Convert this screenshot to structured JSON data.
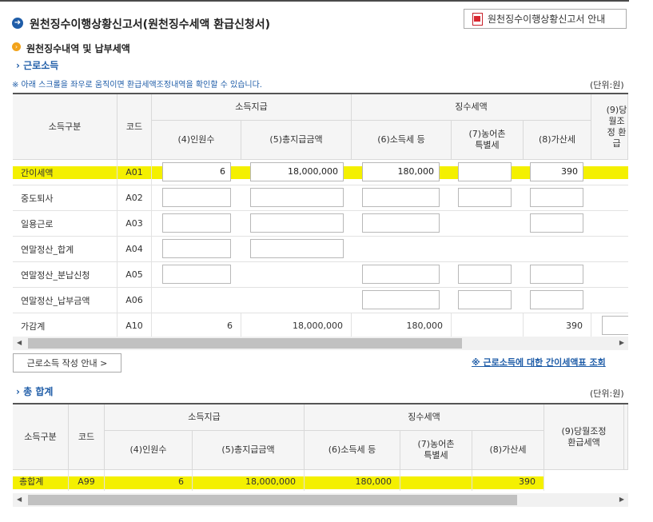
{
  "header": {
    "title": "원천징수이행상황신고서(원천징수세액 환급신청서)",
    "guide_button": "원천징수이행상황신고서 안내",
    "section_title": "원천징수내역 및 납부세액"
  },
  "earned_income": {
    "section_label": "근로소득",
    "notice": "※ 아래 스크롤을 좌우로 움직이면 환급세액조정내역을 확인할 수 있습니다.",
    "unit": "(단위:원)",
    "headers": {
      "category": "소득구분",
      "code": "코드",
      "income_payment": "소득지급",
      "withholding": "징수세액",
      "persons": "(4)인원수",
      "total_pay": "(5)총지급금액",
      "income_tax": "(6)소득세 등",
      "rural_tax": "(7)농어촌 특별세",
      "penalty": "(8)가산세",
      "refund_partial": "(9)당월조정 환급"
    },
    "rows": [
      {
        "label": "간이세액",
        "code": "A01",
        "persons": "6",
        "total_pay": "18,000,000",
        "income_tax": "180,000",
        "rural_tax": "",
        "penalty": "390"
      },
      {
        "label": "중도퇴사",
        "code": "A02",
        "persons": "",
        "total_pay": "",
        "income_tax": "",
        "rural_tax": "",
        "penalty": ""
      },
      {
        "label": "일용근로",
        "code": "A03",
        "persons": "",
        "total_pay": "",
        "income_tax": "",
        "rural_tax": "",
        "penalty": ""
      },
      {
        "label": "연말정산_합계",
        "code": "A04",
        "persons": "",
        "total_pay": "",
        "income_tax": "",
        "rural_tax": "",
        "penalty": ""
      },
      {
        "label": "연말정산_분납신청",
        "code": "A05",
        "persons": "",
        "total_pay": "",
        "income_tax": "",
        "rural_tax": "",
        "penalty": ""
      },
      {
        "label": "연말정산_납부금액",
        "code": "A06",
        "persons": "",
        "total_pay": "",
        "income_tax": "",
        "rural_tax": "",
        "penalty": ""
      },
      {
        "label": "가감계",
        "code": "A10",
        "persons": "6",
        "total_pay": "18,000,000",
        "income_tax": "180,000",
        "rural_tax": "",
        "penalty": "390"
      }
    ],
    "write_guide_button": "근로소득 작성 안내 >",
    "simplified_tax_link": "※ 근로소득에 대한 간이세액표 조회"
  },
  "grand_total": {
    "section_label": "총 합계",
    "unit": "(단위:원)",
    "headers": {
      "category": "소득구분",
      "code": "코드",
      "income_payment": "소득지급",
      "withholding": "징수세액",
      "persons": "(4)인원수",
      "total_pay": "(5)총지급금액",
      "income_tax": "(6)소득세 등",
      "rural_tax": "(7)농어촌 특별세",
      "penalty": "(8)가산세",
      "refund": "(9)당월조정 환급세액"
    },
    "row": {
      "label": "총합계",
      "code": "A99",
      "persons": "6",
      "total_pay": "18,000,000",
      "income_tax": "180,000",
      "rural_tax": "",
      "penalty": "390"
    }
  },
  "colors": {
    "accent": "#1f5da8",
    "highlight": "#f4f000",
    "header_bg": "#f5f5f5"
  }
}
